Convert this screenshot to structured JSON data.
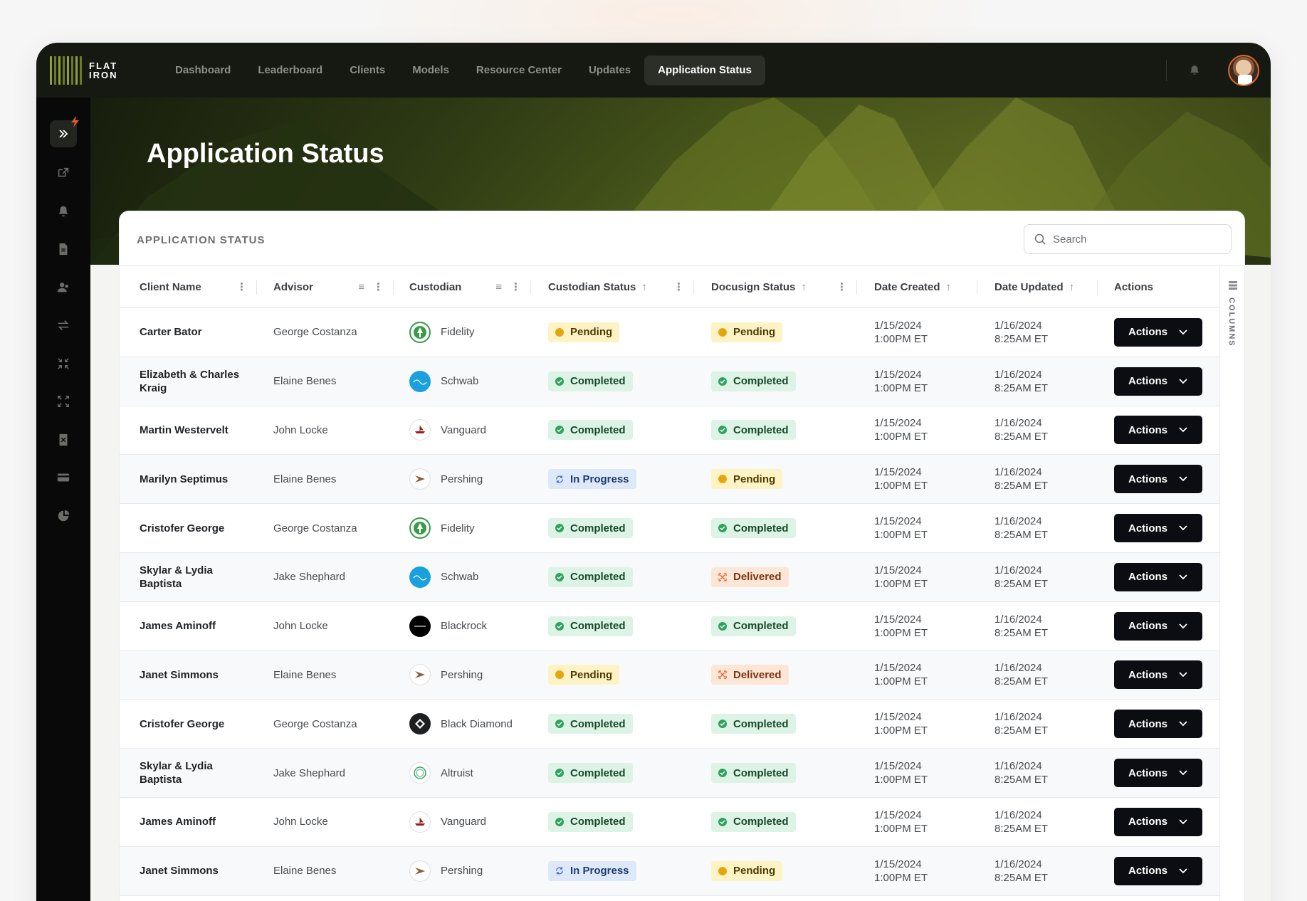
{
  "brand": {
    "line1": "FLAT",
    "line2": "IRON"
  },
  "nav": {
    "items": [
      "Dashboard",
      "Leaderboard",
      "Clients",
      "Models",
      "Resource Center",
      "Updates",
      "Application Status"
    ],
    "active": "Application Status"
  },
  "hero": {
    "title": "Application Status"
  },
  "card": {
    "title": "APPLICATION STATUS",
    "search_placeholder": "Search",
    "columns_label": "COLUMNS"
  },
  "table": {
    "headers": {
      "client": "Client Name",
      "advisor": "Advisor",
      "custodian": "Custodian",
      "custodian_status": "Custodian Status",
      "docusign_status": "Docusign Status",
      "date_created": "Date Created",
      "date_updated": "Date Updated",
      "actions": "Actions"
    },
    "rows": [
      {
        "client": "Carter Bator",
        "advisor": "George Costanza",
        "custodian": "Fidelity",
        "cstat": "Pending",
        "dstat": "Pending",
        "created_date": "1/15/2024",
        "created_time": "1:00PM ET",
        "updated_date": "1/16/2024",
        "updated_time": "8:25AM ET",
        "action": "Actions"
      },
      {
        "client": "Elizabeth & Charles Kraig",
        "advisor": "Elaine Benes",
        "custodian": "Schwab",
        "cstat": "Completed",
        "dstat": "Completed",
        "created_date": "1/15/2024",
        "created_time": "1:00PM ET",
        "updated_date": "1/16/2024",
        "updated_time": "8:25AM ET",
        "action": "Actions"
      },
      {
        "client": "Martin Westervelt",
        "advisor": "John Locke",
        "custodian": "Vanguard",
        "cstat": "Completed",
        "dstat": "Completed",
        "created_date": "1/15/2024",
        "created_time": "1:00PM ET",
        "updated_date": "1/16/2024",
        "updated_time": "8:25AM ET",
        "action": "Actions"
      },
      {
        "client": "Marilyn Septimus",
        "advisor": "Elaine Benes",
        "custodian": "Pershing",
        "cstat": "In Progress",
        "dstat": "Pending",
        "created_date": "1/15/2024",
        "created_time": "1:00PM ET",
        "updated_date": "1/16/2024",
        "updated_time": "8:25AM ET",
        "action": "Actions"
      },
      {
        "client": "Cristofer George",
        "advisor": "George Costanza",
        "custodian": "Fidelity",
        "cstat": "Completed",
        "dstat": "Completed",
        "created_date": "1/15/2024",
        "created_time": "1:00PM ET",
        "updated_date": "1/16/2024",
        "updated_time": "8:25AM ET",
        "action": "Actions"
      },
      {
        "client": "Skylar & Lydia Baptista",
        "advisor": "Jake Shephard",
        "custodian": "Schwab",
        "cstat": "Completed",
        "dstat": "Delivered",
        "created_date": "1/15/2024",
        "created_time": "1:00PM ET",
        "updated_date": "1/16/2024",
        "updated_time": "8:25AM ET",
        "action": "Actions"
      },
      {
        "client": "James Aminoff",
        "advisor": "John Locke",
        "custodian": "Blackrock",
        "cstat": "Completed",
        "dstat": "Completed",
        "created_date": "1/15/2024",
        "created_time": "1:00PM ET",
        "updated_date": "1/16/2024",
        "updated_time": "8:25AM ET",
        "action": "Actions"
      },
      {
        "client": "Janet Simmons",
        "advisor": "Elaine Benes",
        "custodian": "Pershing",
        "cstat": "Pending",
        "dstat": "Delivered",
        "created_date": "1/15/2024",
        "created_time": "1:00PM ET",
        "updated_date": "1/16/2024",
        "updated_time": "8:25AM ET",
        "action": "Actions"
      },
      {
        "client": "Cristofer George",
        "advisor": "George Costanza",
        "custodian": "Black Diamond",
        "cstat": "Completed",
        "dstat": "Completed",
        "created_date": "1/15/2024",
        "created_time": "1:00PM ET",
        "updated_date": "1/16/2024",
        "updated_time": "8:25AM ET",
        "action": "Actions"
      },
      {
        "client": "Skylar & Lydia Baptista",
        "advisor": "Jake Shephard",
        "custodian": "Altruist",
        "cstat": "Completed",
        "dstat": "Completed",
        "created_date": "1/15/2024",
        "created_time": "1:00PM ET",
        "updated_date": "1/16/2024",
        "updated_time": "8:25AM ET",
        "action": "Actions"
      },
      {
        "client": "James Aminoff",
        "advisor": "John Locke",
        "custodian": "Vanguard",
        "cstat": "Completed",
        "dstat": "Completed",
        "created_date": "1/15/2024",
        "created_time": "1:00PM ET",
        "updated_date": "1/16/2024",
        "updated_time": "8:25AM ET",
        "action": "Actions"
      },
      {
        "client": "Janet Simmons",
        "advisor": "Elaine Benes",
        "custodian": "Pershing",
        "cstat": "In Progress",
        "dstat": "Pending",
        "created_date": "1/15/2024",
        "created_time": "1:00PM ET",
        "updated_date": "1/16/2024",
        "updated_time": "8:25AM ET",
        "action": "Actions"
      }
    ]
  },
  "colors": {
    "topbar": "#151911",
    "sidebar": "#090909",
    "action_button": "#0b0d12",
    "pending_dot": "#e3a60f",
    "completed_dot": "#2fa35c",
    "accent_spark": "#e5582a"
  },
  "icons": {
    "sidebar": [
      "external-link-icon",
      "bell-icon",
      "document-icon",
      "users-icon",
      "transfer-icon",
      "collapse-icon",
      "expand-icon",
      "file-x-icon",
      "card-icon",
      "pie-chart-icon"
    ],
    "custodian_logos": {
      "Fidelity": "fidelity-logo",
      "Schwab": "schwab-logo",
      "Vanguard": "vanguard-logo",
      "Pershing": "pershing-logo",
      "Blackrock": "blackrock-logo",
      "Black Diamond": "black-diamond-logo",
      "Altruist": "altruist-logo"
    }
  }
}
